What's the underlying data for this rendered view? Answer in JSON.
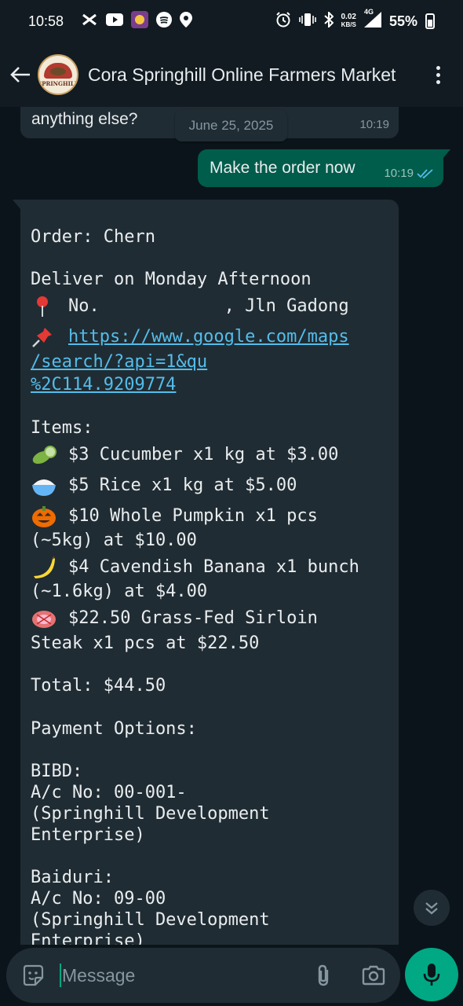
{
  "statusbar": {
    "time": "10:58",
    "net_speed_value": "0.02",
    "net_speed_unit": "KB/S",
    "network": "4G",
    "battery": "55%",
    "icons": [
      "capcut-icon",
      "youtube-icon",
      "app-icon",
      "spotify-icon",
      "location-icon",
      "alarm-icon",
      "vibrate-icon",
      "bluetooth-icon",
      "signal-icon",
      "battery-icon"
    ]
  },
  "header": {
    "title": "Cora Springhill Online Farmers Market",
    "avatar_text": "SPRINGHILL"
  },
  "chat": {
    "prev_message": {
      "text": "anything else?",
      "time": "10:19"
    },
    "date_chip": "June 25, 2025",
    "outgoing": {
      "text": "Make the order now",
      "time": "10:19",
      "status": "read"
    },
    "order": {
      "line_order": "Order: Chern",
      "line_deliver": "Deliver on Monday Afternoon",
      "line_address": "No.            , Jln Gadong",
      "link_1": "https://www.google.com/maps",
      "link_2": "/search/?api=1&qu",
      "link_3": "%2C114.9209774",
      "items_header": "Items:",
      "item_1": "$3 Cucumber x1 kg at $3.00",
      "item_2": "$5 Rice x1 kg at $5.00",
      "item_3a": "$10 Whole Pumpkin x1 pcs",
      "item_3b": "(~5kg) at $10.00",
      "item_4a": "$4 Cavendish Banana x1 bunch",
      "item_4b": "(~1.6kg) at $4.00",
      "item_5a": "$22.50 Grass-Fed Sirloin",
      "item_5b": "Steak x1 pcs at $22.50",
      "total": "Total: $44.50",
      "payment_header": "Payment Options:",
      "bank_1": "BIBD:",
      "bank_1_acc": "A/c No: 00-001-",
      "bank_1_name_1": "(Springhill Development",
      "bank_1_name_2": "Enterprise)",
      "bank_2": "Baiduri:",
      "bank_2_acc": "A/c No: 09-00",
      "bank_2_name_1": "(Springhill Development",
      "bank_2_name_2": "Enterprise)"
    }
  },
  "input": {
    "placeholder": "Message"
  },
  "colors": {
    "background": "#0b141a",
    "incoming_bubble": "#202c33",
    "outgoing_bubble": "#005c4b",
    "accent": "#00a884",
    "link": "#53bdeb",
    "read_ticks": "#53bdeb"
  }
}
